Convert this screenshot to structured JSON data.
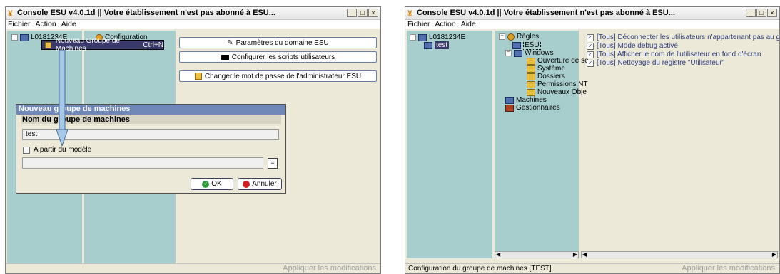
{
  "left_window": {
    "title": "Console ESU v4.0.1d || Votre établissement n'est pas abonné à ESU...",
    "menu": [
      "Fichier",
      "Action",
      "Aide"
    ],
    "tree_root": "L0181234E",
    "tree_second": "Configuration",
    "buttons": {
      "params": "Paramètres du domaine ESU",
      "scripts": "Configurer les scripts utilisateurs",
      "password": "Changer le mot de passe de l'administrateur ESU"
    },
    "context_menu": {
      "label": "Nouveau Groupe de Machines",
      "shortcut": "Ctrl+N"
    },
    "dialog": {
      "title": "Nouveau groupe de machines",
      "header": "Nom du groupe de machines",
      "name_value": "test",
      "checkbox_label": "A partir du modèle",
      "model_value": "",
      "ok": "OK",
      "cancel": "Annuler"
    },
    "status_apply": "Appliquer les modifications"
  },
  "right_window": {
    "title": "Console ESU v4.0.1d || Votre établissement n'est pas abonné à ESU...",
    "menu": [
      "Fichier",
      "Action",
      "Aide"
    ],
    "left_tree": {
      "root": "L0181234E",
      "child": "test"
    },
    "mid_tree": {
      "regles": "Règles",
      "esu": "ESU",
      "windows": "Windows",
      "ouverture": "Ouverture de se",
      "systeme": "Système",
      "dossiers": "Dossiers",
      "permissions": "Permissions NT",
      "nouveaux": "Nouveaux Obje",
      "machines": "Machines",
      "gestionnaires": "Gestionnaires"
    },
    "rules": [
      "[Tous] Déconnecter les utilisateurs n'appartenant pas au groupe de ma",
      "[Tous] Mode debug activé",
      "[Tous] Afficher le nom de l'utilisateur en fond d'écran",
      "[Tous] Nettoyage du registre \"Utilisateur\""
    ],
    "status_left": "Configuration du groupe de machines [TEST]",
    "status_apply": "Appliquer les modifications"
  }
}
